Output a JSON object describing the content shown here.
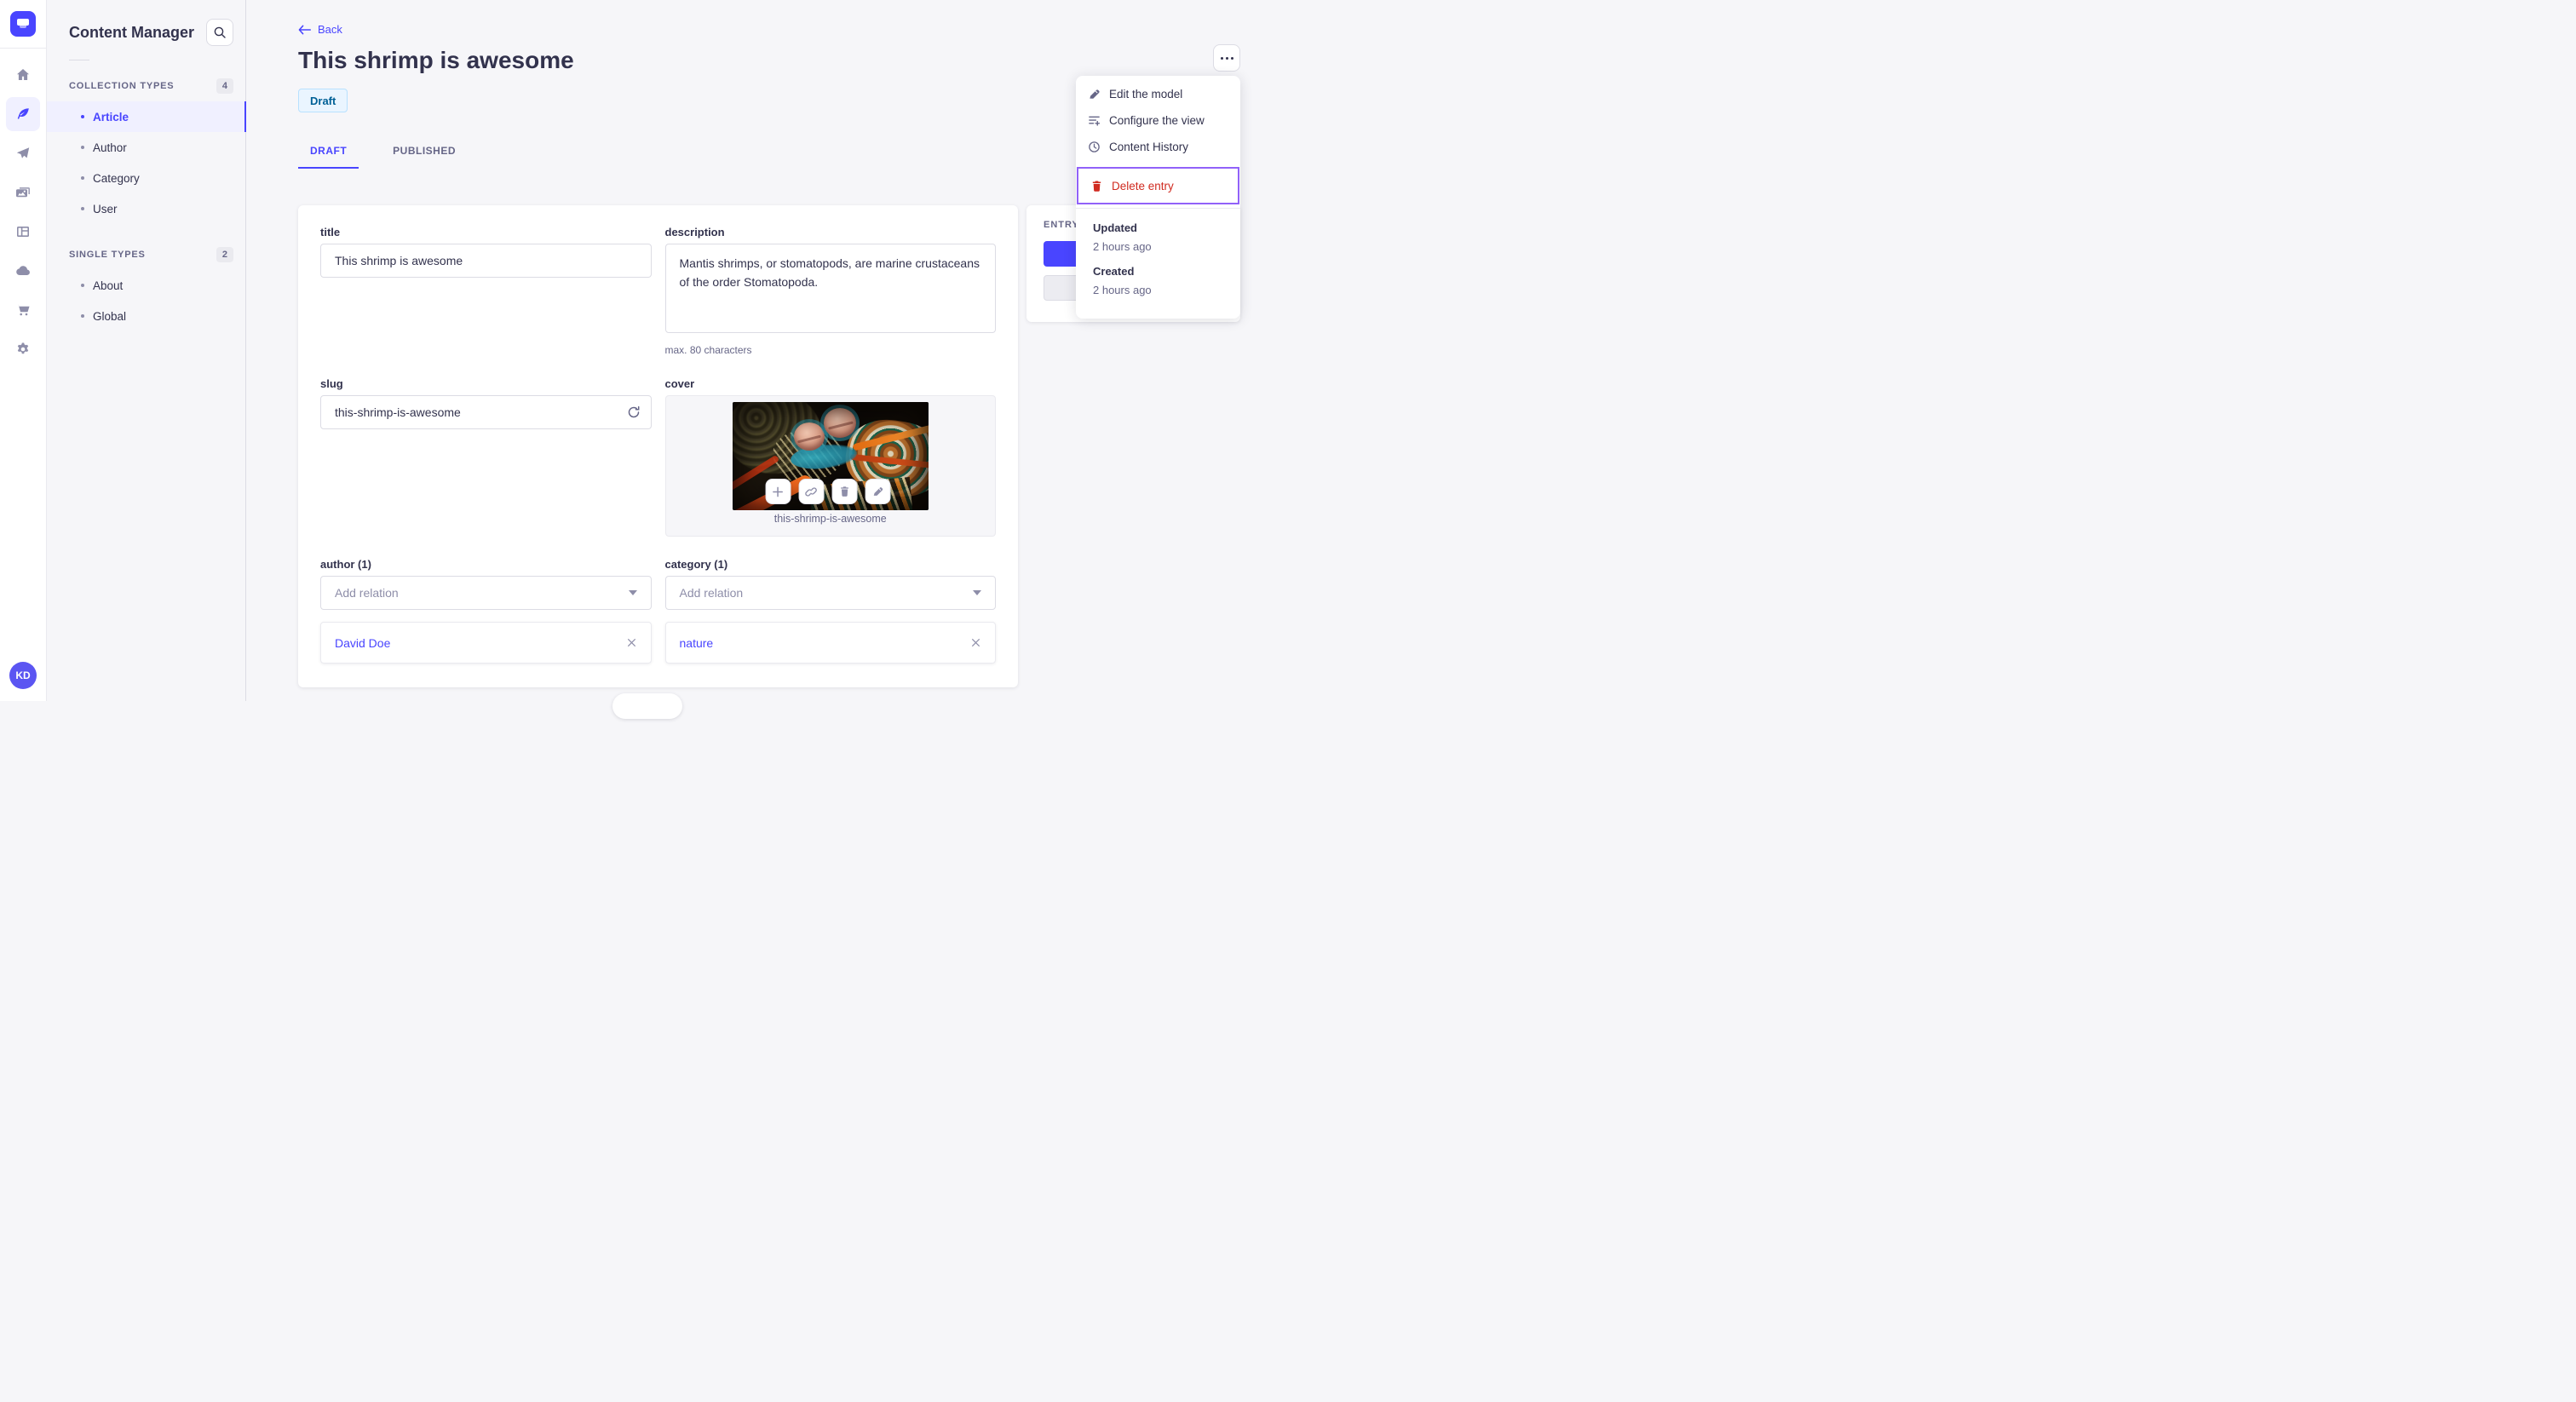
{
  "colors": {
    "accent": "#4945ff",
    "danger": "#d02b20",
    "highlight_outline": "#9161f9",
    "draft_text": "#006096",
    "draft_bg": "#eaf5ff",
    "draft_border": "#b8e1ff"
  },
  "rail": {
    "logo_icon": "strapi-logo",
    "icons": [
      "home",
      "feather",
      "paper-plane",
      "images",
      "layout",
      "cloud",
      "cart",
      "gear"
    ],
    "active_icon": "feather",
    "avatar_initials": "KD"
  },
  "sidebar": {
    "title": "Content Manager",
    "search_icon": "magnifier",
    "sections": [
      {
        "label": "COLLECTION TYPES",
        "count": "4",
        "items": [
          {
            "label": "Article",
            "active": true
          },
          {
            "label": "Author"
          },
          {
            "label": "Category"
          },
          {
            "label": "User"
          }
        ]
      },
      {
        "label": "SINGLE TYPES",
        "count": "2",
        "items": [
          {
            "label": "About"
          },
          {
            "label": "Global"
          }
        ]
      }
    ]
  },
  "header": {
    "back_label": "Back",
    "title": "This shrimp is awesome",
    "status": "Draft",
    "more_icon": "ellipsis"
  },
  "tabs": {
    "draft": "DRAFT",
    "published": "PUBLISHED"
  },
  "form": {
    "title": {
      "label": "title",
      "value": "This shrimp is awesome"
    },
    "description": {
      "label": "description",
      "value": "Mantis shrimps, or stomatopods, are marine crustaceans of the order Stomatopoda.",
      "hint": "max. 80 characters"
    },
    "slug": {
      "label": "slug",
      "value": "this-shrimp-is-awesome",
      "refresh_icon": "regenerate"
    },
    "cover": {
      "label": "cover",
      "caption": "this-shrimp-is-awesome",
      "action_icons": [
        "plus",
        "link",
        "trash",
        "pencil"
      ]
    },
    "author": {
      "label": "author (1)",
      "placeholder": "Add relation",
      "relation": "David Doe"
    },
    "category": {
      "label": "category (1)",
      "placeholder": "Add relation",
      "relation": "nature"
    }
  },
  "entry_panel": {
    "title": "ENTRY"
  },
  "menu": {
    "items": [
      {
        "label": "Edit the model",
        "icon": "pencil"
      },
      {
        "label": "Configure the view",
        "icon": "list-plus"
      },
      {
        "label": "Content History",
        "icon": "clock"
      },
      {
        "label": "Delete entry",
        "icon": "trash",
        "danger": true,
        "highlighted": true
      }
    ],
    "meta": [
      {
        "label": "Updated",
        "value": "2 hours ago"
      },
      {
        "label": "Created",
        "value": "2 hours ago"
      }
    ]
  }
}
